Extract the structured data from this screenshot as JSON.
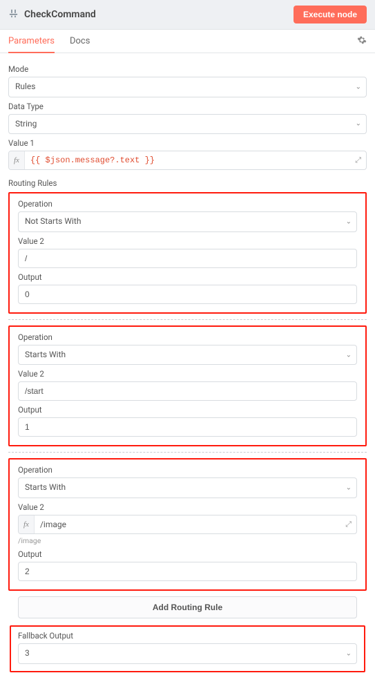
{
  "header": {
    "title": "CheckCommand",
    "execute_label": "Execute node"
  },
  "tabs": {
    "parameters": "Parameters",
    "docs": "Docs"
  },
  "mode": {
    "label": "Mode",
    "value": "Rules"
  },
  "data_type": {
    "label": "Data Type",
    "value": "String"
  },
  "value1": {
    "label": "Value 1",
    "value": "{{ $json.message?.text }}"
  },
  "routing_rules_label": "Routing Rules",
  "rules": [
    {
      "operation_label": "Operation",
      "operation_value": "Not Starts With",
      "value2_label": "Value 2",
      "value2_value": "/",
      "output_label": "Output",
      "output_value": "0",
      "value2_fx": false,
      "value2_hint": ""
    },
    {
      "operation_label": "Operation",
      "operation_value": "Starts With",
      "value2_label": "Value 2",
      "value2_value": "/start",
      "output_label": "Output",
      "output_value": "1",
      "value2_fx": false,
      "value2_hint": ""
    },
    {
      "operation_label": "Operation",
      "operation_value": "Starts With",
      "value2_label": "Value 2",
      "value2_value": "/image",
      "output_label": "Output",
      "output_value": "2",
      "value2_fx": true,
      "value2_hint": "/image"
    }
  ],
  "add_rule_label": "Add Routing Rule",
  "fallback": {
    "label": "Fallback Output",
    "value": "3"
  }
}
